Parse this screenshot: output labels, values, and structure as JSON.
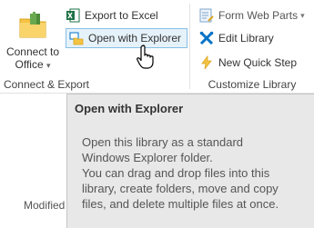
{
  "ribbon": {
    "connect_group": {
      "label": "Connect & Export",
      "connect_to_office": {
        "line1": "Connect to",
        "line2": "Office",
        "dropdown_glyph": "▾",
        "icon": "folder-with-office-icon"
      },
      "export_to_excel": {
        "label": "Export to Excel",
        "icon": "excel-icon"
      },
      "open_with_explorer": {
        "label": "Open with Explorer",
        "icon": "explorer-folder-icon",
        "state": "hover"
      }
    },
    "customize_group": {
      "label": "Customize Library",
      "form_web_parts": {
        "label": "Form Web Parts",
        "dropdown_glyph": "▾",
        "icon": "form-web-parts-icon"
      },
      "edit_library": {
        "label": "Edit Library",
        "icon": "edit-library-icon"
      },
      "new_quick_step": {
        "label": "New Quick Step",
        "icon": "lightning-icon"
      }
    }
  },
  "tooltip": {
    "title": "Open with Explorer",
    "body_lines": [
      "Open this library as a standard",
      "Windows Explorer folder.",
      "You can drag and drop files into this",
      "library, create folders, move and copy",
      "files, and delete multiple files at once."
    ]
  },
  "page": {
    "modified_label": "Modified"
  },
  "colors": {
    "hover_border": "#86bfe6",
    "hover_fill": "#e6f2fa",
    "tooltip_bg": "#e8e8e8",
    "excel_green": "#1e7145",
    "folder_yellow": "#f5c342",
    "sharepoint_blue": "#0072c6"
  }
}
